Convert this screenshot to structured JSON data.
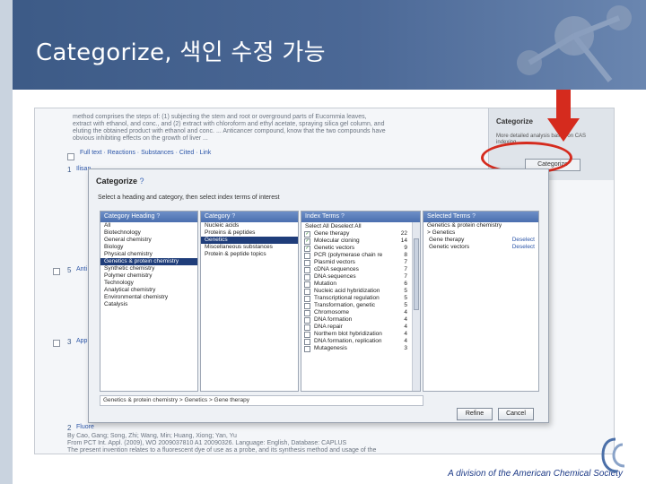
{
  "slide": {
    "title": "Categorize, 색인 수정 가능",
    "footer": "A division of the American Chemical Society"
  },
  "background": {
    "lines": [
      "method comprises the steps of: (1) subjecting the stem and root or overground parts of Eucommia leaves,",
      "extract with ethanol, and conc., and (2) extract with chloroform and ethyl acetate, spraying silica gel column, and",
      "eluting the obtained product with ethanol and conc. ... Anticancer compound, know that the two compounds have",
      "obvious inhibiting effects on the growth of liver ..."
    ],
    "link_line": "Full text  ·  Reactions  ·  Substances  ·  Cited  ·  Link",
    "items": [
      {
        "number": "1",
        "title": "Ilisan"
      },
      {
        "number": "5",
        "title": "Anti"
      },
      {
        "number": "3",
        "title": "Appli"
      },
      {
        "number": "2",
        "title": "Fluore"
      }
    ],
    "bottom_lines": [
      "By Cao, Gang; Song, Zhi; Wang, Min; Huang, Xiong; Yan, Yu",
      "From PCT Int. Appl. (2009), WO 2009037810 A1 20090326. Language: English, Database: CAPLUS",
      "The present invention relates to a fluorescent dye of use as a probe, and its synthesis method and usage of the"
    ]
  },
  "side_panel": {
    "title": "Categorize",
    "description": "More detailed analysis based on CAS indexing",
    "button": "Categorize"
  },
  "dialog": {
    "title": "Categorize",
    "help_icon": "?",
    "instructions": "Select a heading and category, then select index terms of interest",
    "columns": {
      "heading": "Category Heading",
      "category": "Category",
      "index_terms": "Index Terms",
      "selected_terms": "Selected Terms"
    },
    "headings": [
      "All",
      "Biotechnology",
      "General chemistry",
      "Biology",
      "Physical chemistry",
      "Genetics & protein chemistry",
      "Synthetic chemistry",
      "Polymer chemistry",
      "Technology",
      "Analytical chemistry",
      "Environmental chemistry",
      "Catalysis"
    ],
    "headings_selected_index": 5,
    "categories": [
      "Nucleic acids",
      "Proteins & peptides",
      "Genetics",
      "Miscellaneous substances",
      "Protein & peptide topics"
    ],
    "categories_selected_index": 2,
    "index_select_all": "Select All",
    "index_deselect_all": "Deselect All",
    "index_terms": [
      {
        "term": "Gene therapy",
        "count": "22",
        "checked": true
      },
      {
        "term": "Molecular cloning",
        "count": "14",
        "checked": true
      },
      {
        "term": "Genetic vectors",
        "count": "9",
        "checked": true
      },
      {
        "term": "PCR (polymerase chain re",
        "count": "8",
        "checked": false
      },
      {
        "term": "Plasmid vectors",
        "count": "7",
        "checked": false
      },
      {
        "term": "cDNA sequences",
        "count": "7",
        "checked": false
      },
      {
        "term": "DNA sequences",
        "count": "7",
        "checked": false
      },
      {
        "term": "Mutation",
        "count": "6",
        "checked": false
      },
      {
        "term": "Nucleic acid hybridization",
        "count": "5",
        "checked": false
      },
      {
        "term": "Transcriptional regulation",
        "count": "5",
        "checked": false
      },
      {
        "term": "Transformation, genetic",
        "count": "5",
        "checked": false
      },
      {
        "term": "Chromosome",
        "count": "4",
        "checked": false
      },
      {
        "term": "DNA formation",
        "count": "4",
        "checked": false
      },
      {
        "term": "DNA repair",
        "count": "4",
        "checked": false
      },
      {
        "term": "Northern blot hybridization",
        "count": "4",
        "checked": false
      },
      {
        "term": "DNA formation, replication",
        "count": "4",
        "checked": false
      },
      {
        "term": "Mutagenesis",
        "count": "3",
        "checked": false
      }
    ],
    "selected_heading": "Genetics & protein chemistry",
    "selected_category": "> Genetics",
    "selected_terms": [
      {
        "term": "Gene therapy",
        "action": "Deselect"
      },
      {
        "term": "Genetic vectors",
        "action": "Deselect"
      }
    ],
    "path": "Genetics & protein chemistry > Genetics > Gene therapy",
    "ok_button": "Refine",
    "cancel_button": "Cancel"
  },
  "colors": {
    "header_blue": "#3c5a86",
    "highlight_red": "#d52b1e",
    "selection_navy": "#1f3d7a"
  }
}
